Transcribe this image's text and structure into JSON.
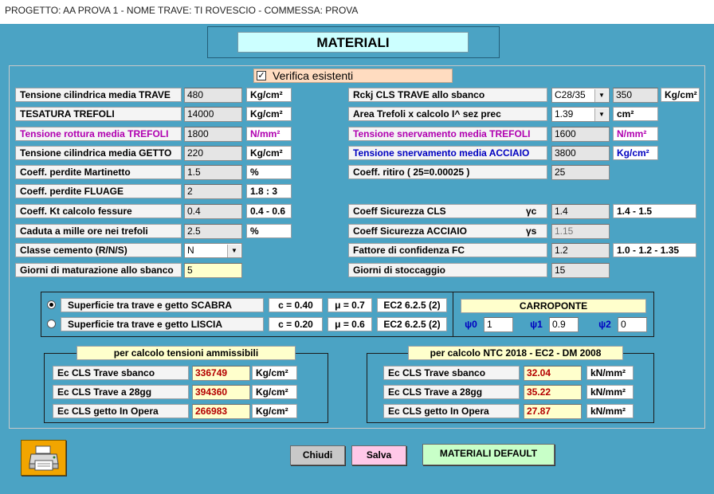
{
  "window": {
    "title": "PROGETTO: AA PROVA 1 - NOME TRAVE: TI ROVESCIO - COMMESSA: PROVA"
  },
  "header": {
    "title": "MATERIALI"
  },
  "verifica": {
    "label": "Verifica esistenti",
    "checked": true,
    "mark": "✓"
  },
  "left": [
    {
      "label": "Tensione cilindrica media TRAVE",
      "value": "480",
      "unit": "Kg/cm²"
    },
    {
      "label": "TESATURA TREFOLI",
      "value": "14000",
      "unit": "Kg/cm²"
    },
    {
      "label": "Tensione rottura media TREFOLI",
      "value": "1800",
      "unit": "N/mm²"
    },
    {
      "label": "Tensione cilindrica media GETTO",
      "value": "220",
      "unit": "Kg/cm²"
    },
    {
      "label": "Coeff. perdite Martinetto",
      "value": "1.5",
      "unit": "%"
    },
    {
      "label": "Coeff. perdite FLUAGE",
      "value": "2",
      "unit": "1.8  : 3"
    },
    {
      "label": "Coeff. Kt calcolo fessure",
      "value": "0.4",
      "unit": "0.4 - 0.6"
    },
    {
      "label": "Caduta a mille ore nei trefoli",
      "value": "2.5",
      "unit": "%"
    },
    {
      "label": "Classe cemento (R/N/S)",
      "value": "N"
    },
    {
      "label": "Giorni di maturazione allo sbanco",
      "value": "5"
    }
  ],
  "right": {
    "rckj": {
      "label": "Rckj CLS TRAVE allo sbanco",
      "select": "C28/35",
      "value": "350",
      "unit": "Kg/cm²"
    },
    "area": {
      "label": "Area Trefoli x calcolo I^ sez prec",
      "select": "1.39",
      "unit": "cm²"
    },
    "snerv_trefoli": {
      "label": "Tensione snervamento media TREFOLI",
      "value": "1600",
      "unit": "N/mm²"
    },
    "snerv_acciaio": {
      "label": "Tensione snervamento media ACCIAIO",
      "value": "3800",
      "unit": "Kg/cm²"
    },
    "ritiro": {
      "label": "Coeff. ritiro ( 25=0.00025 )",
      "value": "25"
    },
    "sic_cls": {
      "label": "Coeff Sicurezza CLS",
      "symbol": "γc",
      "value": "1.4",
      "range": "1.4 - 1.5"
    },
    "sic_acc": {
      "label": "Coeff Sicurezza ACCIAIO",
      "symbol": "γs",
      "value": "1.15"
    },
    "fc": {
      "label": "Fattore di confidenza FC",
      "value": "1.2",
      "range": "1.0 - 1.2 - 1.35"
    },
    "stoccaggio": {
      "label": "Giorni di stoccaggio",
      "value": "15"
    }
  },
  "surface": [
    {
      "label": "Superficie tra trave e getto  SCABRA",
      "c": "c = 0.40",
      "mu": "μ = 0.7",
      "ref": "EC2 6.2.5 (2)",
      "selected": true
    },
    {
      "label": "Superficie tra trave e getto  LISCIA",
      "c": "c = 0.20",
      "mu": "μ = 0.6",
      "ref": "EC2 6.2.5 (2)",
      "selected": false
    }
  ],
  "carroponte": {
    "title": "CARROPONTE",
    "psi": [
      {
        "symbol": "ψ0",
        "value": "1"
      },
      {
        "symbol": "ψ1",
        "value": "0.9"
      },
      {
        "symbol": "ψ2",
        "value": "0"
      }
    ]
  },
  "ammissibili": {
    "title": "per calcolo tensioni ammissibili",
    "rows": [
      {
        "label": "Ec CLS Trave sbanco",
        "value": "336749",
        "unit": "Kg/cm²"
      },
      {
        "label": "Ec CLS Trave a 28gg",
        "value": "394360",
        "unit": "Kg/cm²"
      },
      {
        "label": "Ec CLS getto In Opera",
        "value": "266983",
        "unit": "Kg/cm²"
      }
    ]
  },
  "ntc": {
    "title": "per calcolo NTC 2018 - EC2 - DM 2008",
    "rows": [
      {
        "label": "Ec CLS Trave sbanco",
        "value": "32.04",
        "unit": "kN/mm²"
      },
      {
        "label": "Ec CLS Trave a 28gg",
        "value": "35.22",
        "unit": "kN/mm²"
      },
      {
        "label": "Ec CLS getto In Opera",
        "value": "27.87",
        "unit": "kN/mm²"
      }
    ]
  },
  "buttons": {
    "chiudi": "Chiudi",
    "salva": "Salva",
    "default": "MATERIALI DEFAULT"
  },
  "colors": {
    "background": "#4ba3c4",
    "header": "#ccffff",
    "yellow": "#ffffcc",
    "salva": "#ffc8e8",
    "default": "#c8ffc8",
    "chiudi": "#c8c8c8",
    "printer": "#f2a500"
  },
  "icons": {
    "print": "printer-icon"
  }
}
